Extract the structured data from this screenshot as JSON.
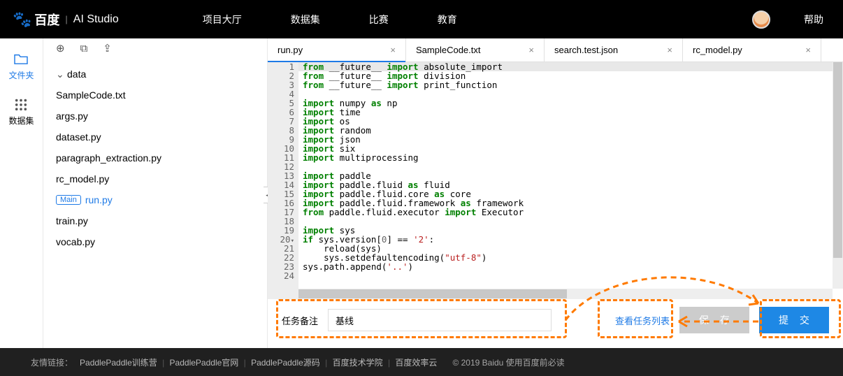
{
  "header": {
    "brand_cn": "百度",
    "brand_sep": "|",
    "brand_sub": "AI Studio",
    "nav": [
      "项目大厅",
      "数据集",
      "比赛",
      "教育"
    ],
    "help": "帮助"
  },
  "sidebar": {
    "items": [
      {
        "label": "文件夹",
        "active": true
      },
      {
        "label": "数据集",
        "active": false
      }
    ]
  },
  "toolbar_actions": [
    "new-file",
    "new-folder",
    "upload"
  ],
  "files": {
    "folder": "data",
    "items": [
      "SampleCode.txt",
      "args.py",
      "dataset.py",
      "paragraph_extraction.py",
      "rc_model.py"
    ],
    "main_item": "run.py",
    "main_badge": "Main",
    "after_main": [
      "train.py",
      "vocab.py"
    ]
  },
  "tabs": [
    {
      "label": "run.py",
      "active": true
    },
    {
      "label": "SampleCode.txt"
    },
    {
      "label": "search.test.json"
    },
    {
      "label": "rc_model.py"
    }
  ],
  "code": [
    {
      "n": 1,
      "tokens": [
        [
          "from",
          "kw"
        ],
        [
          " __future__ ",
          "p"
        ],
        [
          "import",
          "kw"
        ],
        [
          " absolute_import",
          "p"
        ]
      ],
      "hl": true
    },
    {
      "n": 2,
      "tokens": [
        [
          "from",
          "kw"
        ],
        [
          " __future__ ",
          "p"
        ],
        [
          "import",
          "kw"
        ],
        [
          " division",
          "p"
        ]
      ]
    },
    {
      "n": 3,
      "tokens": [
        [
          "from",
          "kw"
        ],
        [
          " __future__ ",
          "p"
        ],
        [
          "import",
          "kw"
        ],
        [
          " print_function",
          "p"
        ]
      ]
    },
    {
      "n": 4,
      "tokens": []
    },
    {
      "n": 5,
      "tokens": [
        [
          "import",
          "kw"
        ],
        [
          " numpy ",
          "p"
        ],
        [
          "as",
          "kw"
        ],
        [
          " np",
          "p"
        ]
      ]
    },
    {
      "n": 6,
      "tokens": [
        [
          "import",
          "kw"
        ],
        [
          " time",
          "p"
        ]
      ]
    },
    {
      "n": 7,
      "tokens": [
        [
          "import",
          "kw"
        ],
        [
          " os",
          "p"
        ]
      ]
    },
    {
      "n": 8,
      "tokens": [
        [
          "import",
          "kw"
        ],
        [
          " random",
          "p"
        ]
      ]
    },
    {
      "n": 9,
      "tokens": [
        [
          "import",
          "kw"
        ],
        [
          " json",
          "p"
        ]
      ]
    },
    {
      "n": 10,
      "tokens": [
        [
          "import",
          "kw"
        ],
        [
          " six",
          "p"
        ]
      ]
    },
    {
      "n": 11,
      "tokens": [
        [
          "import",
          "kw"
        ],
        [
          " multiprocessing",
          "p"
        ]
      ]
    },
    {
      "n": 12,
      "tokens": []
    },
    {
      "n": 13,
      "tokens": [
        [
          "import",
          "kw"
        ],
        [
          " paddle",
          "p"
        ]
      ]
    },
    {
      "n": 14,
      "tokens": [
        [
          "import",
          "kw"
        ],
        [
          " paddle.fluid ",
          "p"
        ],
        [
          "as",
          "kw"
        ],
        [
          " fluid",
          "p"
        ]
      ]
    },
    {
      "n": 15,
      "tokens": [
        [
          "import",
          "kw"
        ],
        [
          " paddle.fluid.core ",
          "p"
        ],
        [
          "as",
          "kw"
        ],
        [
          " core",
          "p"
        ]
      ]
    },
    {
      "n": 16,
      "tokens": [
        [
          "import",
          "kw"
        ],
        [
          " paddle.fluid.framework ",
          "p"
        ],
        [
          "as",
          "kw"
        ],
        [
          " framework",
          "p"
        ]
      ]
    },
    {
      "n": 17,
      "tokens": [
        [
          "from",
          "kw"
        ],
        [
          " paddle.fluid.executor ",
          "p"
        ],
        [
          "import",
          "kw"
        ],
        [
          " Executor",
          "p"
        ]
      ]
    },
    {
      "n": 18,
      "tokens": []
    },
    {
      "n": 19,
      "tokens": [
        [
          "import",
          "kw"
        ],
        [
          " sys",
          "p"
        ]
      ]
    },
    {
      "n": 20,
      "tokens": [
        [
          "if",
          "kw"
        ],
        [
          " sys.version[",
          "p"
        ],
        [
          "0",
          "num"
        ],
        [
          "] == ",
          "p"
        ],
        [
          "'2'",
          "str"
        ],
        [
          ":",
          "p"
        ]
      ],
      "fold": true
    },
    {
      "n": 21,
      "tokens": [
        [
          "    reload(sys)",
          "p"
        ]
      ]
    },
    {
      "n": 22,
      "tokens": [
        [
          "    sys.setdefaultencoding(",
          "p"
        ],
        [
          "\"utf-8\"",
          "str"
        ],
        [
          ")",
          "p"
        ]
      ]
    },
    {
      "n": 23,
      "tokens": [
        [
          "sys.path.append(",
          "p"
        ],
        [
          "'..'",
          "str"
        ],
        [
          ")",
          "p"
        ]
      ]
    },
    {
      "n": 24,
      "tokens": []
    }
  ],
  "taskbar": {
    "label": "任务备注",
    "value": "基线",
    "view_link": "查看任务列表",
    "save": "保 存",
    "submit": "提 交"
  },
  "footer": {
    "label": "友情链接：",
    "links": [
      "PaddlePaddle训练营",
      "PaddlePaddle官网",
      "PaddlePaddle源码",
      "百度技术学院",
      "百度效率云"
    ],
    "copyright": "© 2019 Baidu 使用百度前必读"
  }
}
